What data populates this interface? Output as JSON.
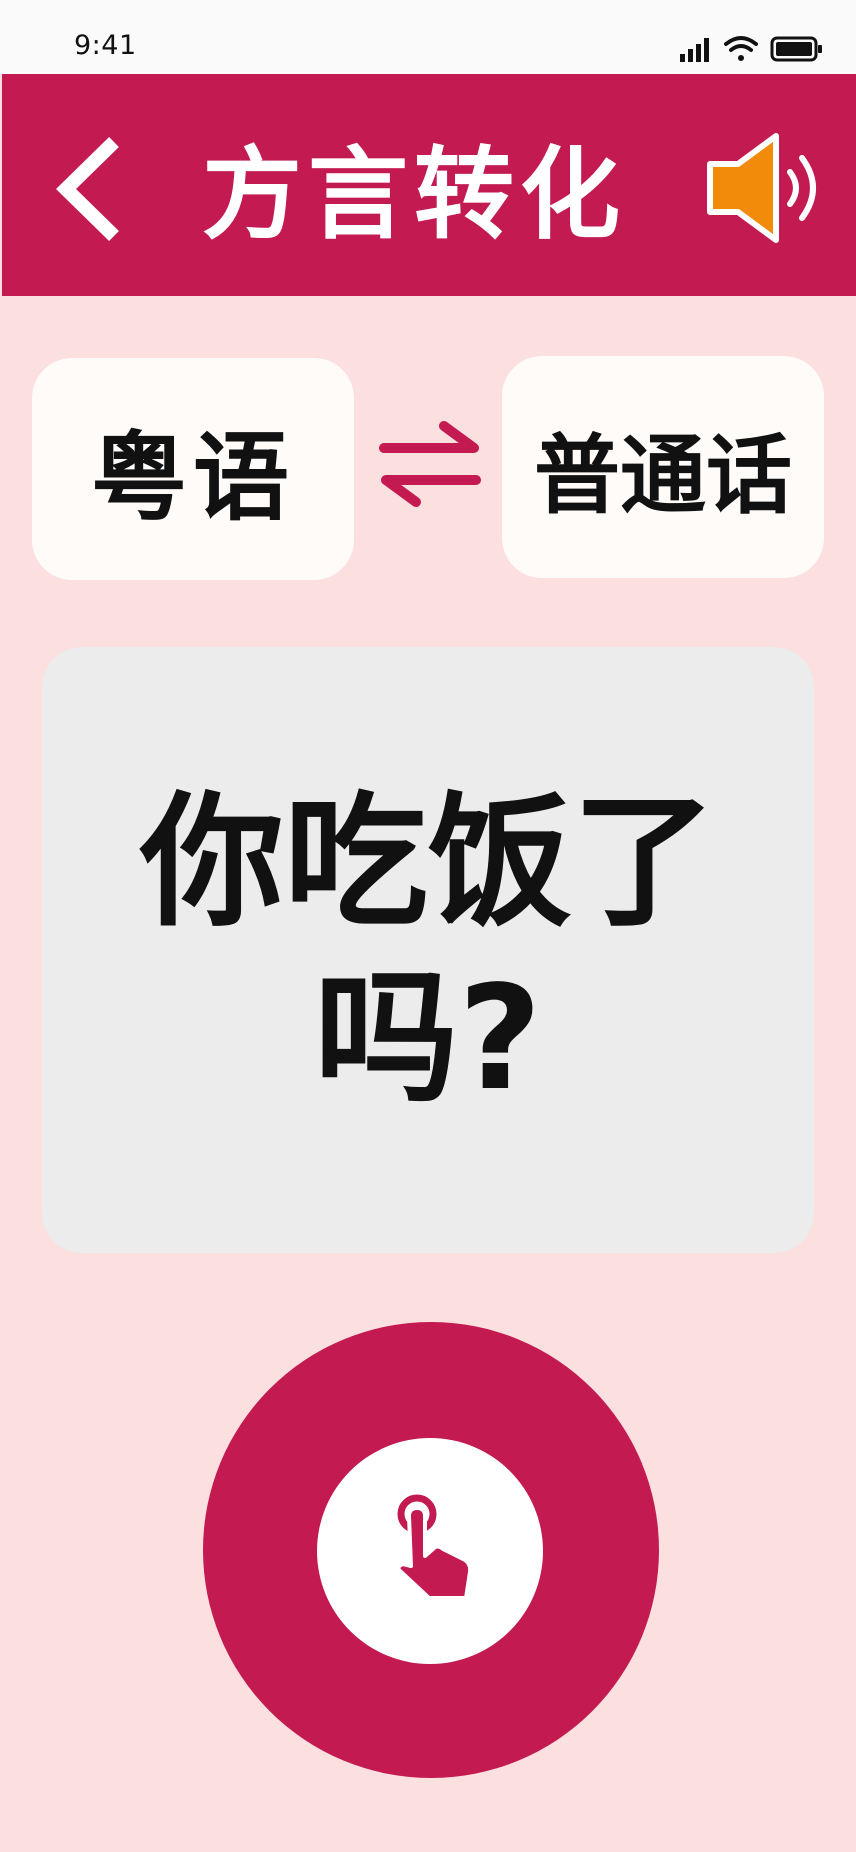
{
  "status_bar": {
    "time": "9:41",
    "icons": [
      "signal-icon",
      "wifi-icon",
      "battery-icon"
    ]
  },
  "header": {
    "title": "方言转化",
    "back_icon": "chevron-left-icon",
    "speaker_icon": "speaker-icon"
  },
  "language": {
    "source": "粤语",
    "target": "普通话",
    "swap_icon": "swap-arrows-icon"
  },
  "translation": {
    "text": "你吃饭了吗?"
  },
  "record": {
    "icon": "touch-hand-icon"
  },
  "colors": {
    "primary": "#c31a52",
    "background": "#fcdfdf",
    "card": "#fefbf9",
    "panel": "#ececec",
    "speaker": "#f28a0a"
  }
}
